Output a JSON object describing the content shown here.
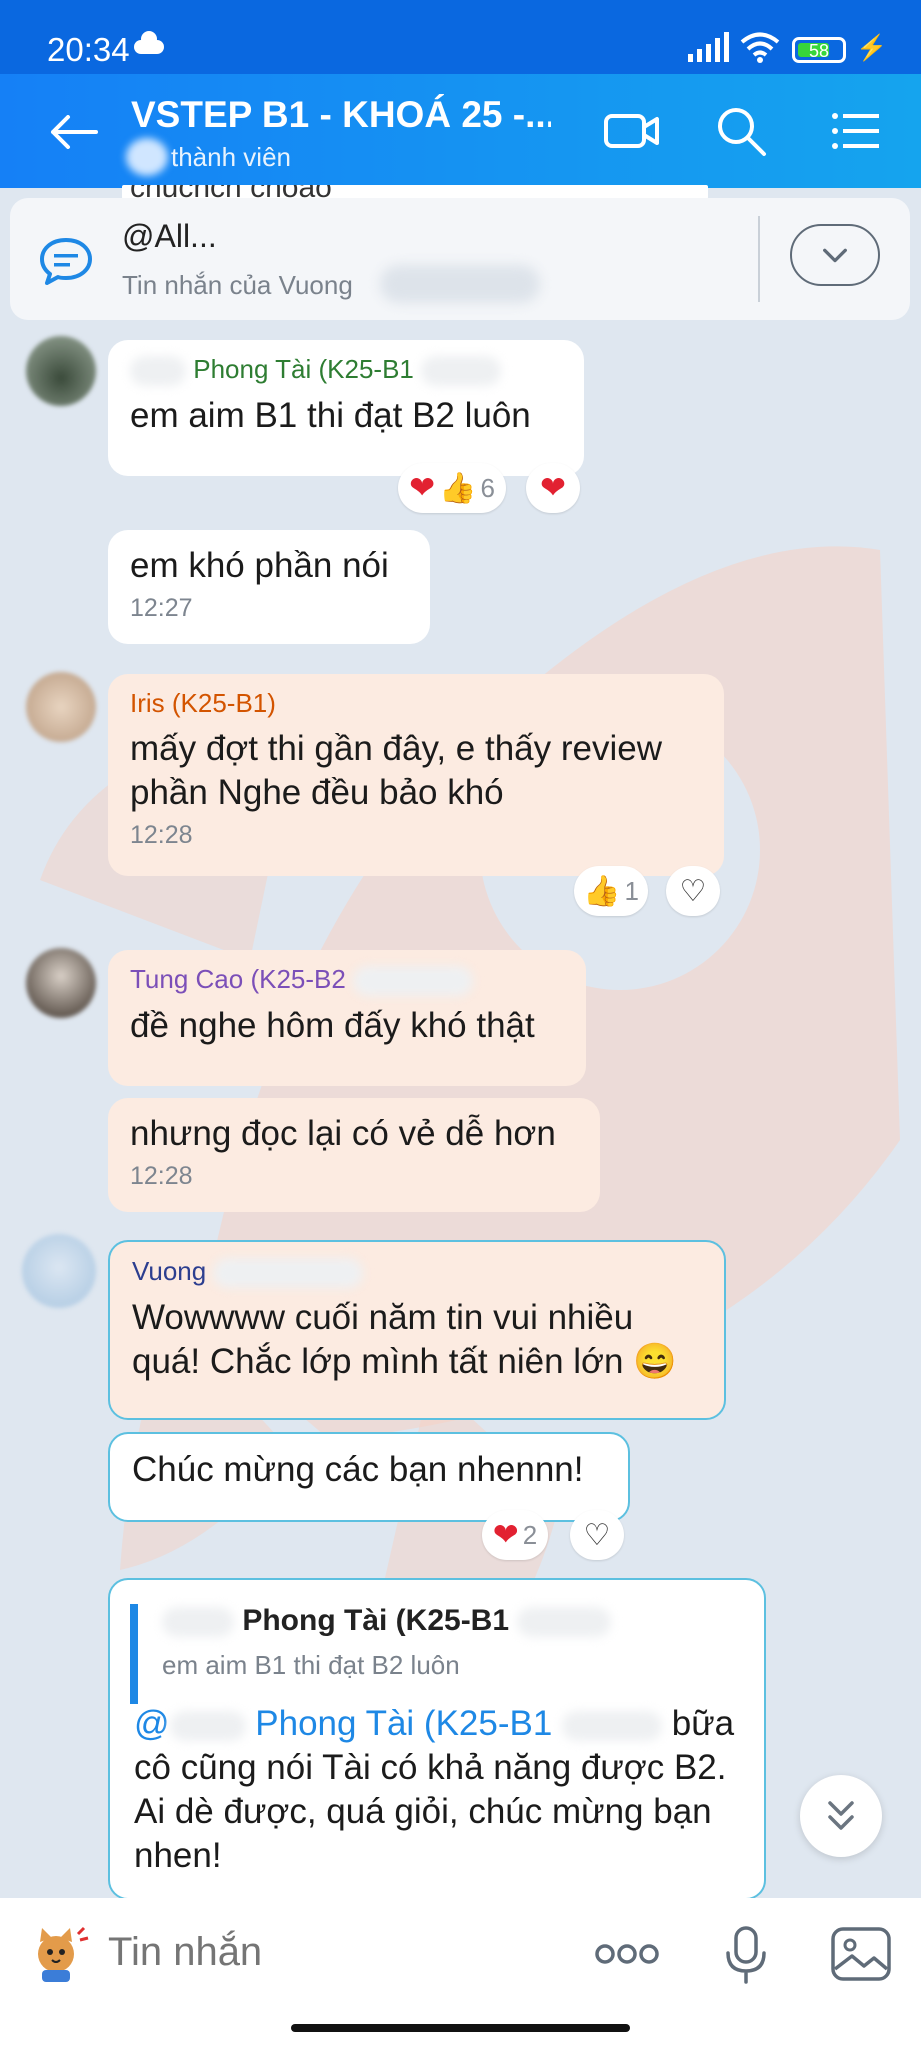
{
  "status_bar": {
    "time": "20:34",
    "battery": "58"
  },
  "header": {
    "title": "VSTEP B1 - KHOÁ 25 -...",
    "members": "thành viên"
  },
  "pinned": {
    "peek": "chuchch choao",
    "title": "@All...",
    "subtitle": "Tin nhắn của Vuong"
  },
  "messages": [
    {
      "sender": "Phong Tài (K25-B1",
      "text": "em aim B1 thi đạt B2 luôn",
      "reactions": {
        "count": "6"
      }
    },
    {
      "text": "em khó phần nói",
      "time": "12:27"
    },
    {
      "sender": "Iris (K25-B1)",
      "text": "mấy đợt thi gần đây, e thấy review phần Nghe đều bảo khó",
      "time": "12:28",
      "reactions": {
        "count": "1"
      }
    },
    {
      "sender": "Tung Cao (K25-B2",
      "text": "đề nghe hôm đấy khó thật"
    },
    {
      "text": "nhưng đọc lại có vẻ dễ hơn",
      "time": "12:28"
    },
    {
      "sender": "Vuong",
      "text": "Wowwww cuối năm tin vui nhiều quá! Chắc lớp mình tất niên lớn 😄"
    },
    {
      "text": "Chúc mừng các bạn nhennn!",
      "reactions": {
        "count": "2"
      }
    },
    {
      "quote_name": "Phong Tài (K25-B1",
      "quote_text": "em aim B1 thi đạt B2 luôn",
      "mention_at": "@",
      "mention_name": "Phong Tài (K25-B1",
      "text_after_mention": "bữa",
      "text": "cô cũng nói Tài có khả năng được B2. Ai dè được, quá giỏi, chúc mừng bạn nhen!"
    }
  ],
  "composer": {
    "placeholder": "Tin nhắn"
  },
  "colors": {
    "header_start": "#1580f6",
    "header_end": "#15a4ee",
    "phong_name": "#2e7d32",
    "iris_name": "#d35400",
    "tung_name": "#7b4fb8",
    "vuong_name": "#2c3e8f",
    "mention": "#1e88e5",
    "heart": "#e22131"
  }
}
